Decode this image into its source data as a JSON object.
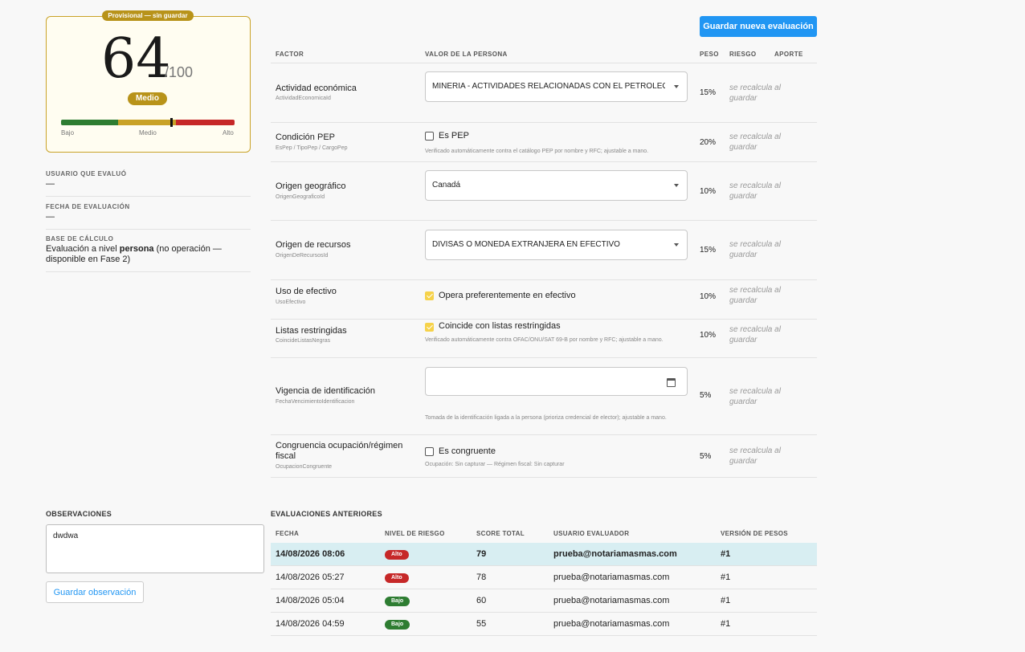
{
  "score_card": {
    "badge": "Provisional — sin guardar",
    "score": "64",
    "denominator": "/100",
    "level": "Medio",
    "gauge_labels": {
      "low": "Bajo",
      "mid": "Medio",
      "high": "Alto"
    },
    "gauge_value": 64
  },
  "meta": {
    "evaluator_label": "USUARIO QUE EVALUÓ",
    "evaluator_value": "—",
    "date_label": "FECHA DE EVALUACIÓN",
    "date_value": "—",
    "base_label": "BASE DE CÁLCULO",
    "base_pre": "Evaluación a nivel ",
    "base_bold": "persona",
    "base_post": " (no operación — disponible en Fase 2)"
  },
  "actions": {
    "save_new": "Guardar nueva evaluación",
    "save_obs": "Guardar observación"
  },
  "table_headers": {
    "factor": "FACTOR",
    "value": "VALOR DE LA PERSONA",
    "weight": "PESO",
    "risk": "RIESGO",
    "contribution": "APORTE"
  },
  "recalc_text": "se recalcula al guardar",
  "factors": [
    {
      "name": "Actividad económica",
      "code": "ActividadEconomicaId",
      "weight": "15%",
      "select": "MINERIA - ACTIVIDADES RELACIONADAS CON EL PETROLEO ..."
    },
    {
      "name": "Condición PEP",
      "code": "EsPep / TipoPep / CargoPep",
      "weight": "20%",
      "check": "Es PEP",
      "hint": "Verificado automáticamente contra el catálogo PEP por nombre y RFC; ajustable a mano."
    },
    {
      "name": "Origen geográfico",
      "code": "OrigenGeograficoId",
      "weight": "10%",
      "select": "Canadá"
    },
    {
      "name": "Origen de recursos",
      "code": "OrigenDeRecursosId",
      "weight": "15%",
      "select": "DIVISAS O MONEDA EXTRANJERA EN EFECTIVO"
    },
    {
      "name": "Uso de efectivo",
      "code": "UsoEfectivo",
      "weight": "10%",
      "check": "Opera preferentemente en efectivo"
    },
    {
      "name": "Listas restringidas",
      "code": "CoincideListasNegras",
      "weight": "10%",
      "check": "Coincide con listas restringidas",
      "hint": "Verificado automáticamente contra OFAC/ONU/SAT 69-B por nombre y RFC; ajustable a mano."
    },
    {
      "name": "Vigencia de identificación",
      "code": "FechaVencimientoIdentificacion",
      "weight": "5%",
      "hint": "Tomada de la identificación ligada a la persona (prioriza credencial de elector); ajustable a mano."
    },
    {
      "name": "Congruencia ocupación/régimen fiscal",
      "code": "OcupacionCongruente",
      "weight": "5%",
      "check": "Es congruente",
      "hint": "Ocupación: Sin capturar — Régimen fiscal: Sin capturar"
    }
  ],
  "observations": {
    "title": "OBSERVACIONES",
    "text": "dwdwa"
  },
  "history": {
    "title": "EVALUACIONES ANTERIORES",
    "headers": {
      "date": "FECHA",
      "level": "NIVEL DE RIESGO",
      "score": "SCORE TOTAL",
      "user": "USUARIO EVALUADOR",
      "version": "VERSIÓN DE PESOS"
    },
    "rows": [
      {
        "date": "14/08/2026 08:06",
        "level": "Alto",
        "score": "79",
        "user": "prueba@notariamasmas.com",
        "version": "#1"
      },
      {
        "date": "14/08/2026 05:27",
        "level": "Alto",
        "score": "78",
        "user": "prueba@notariamasmas.com",
        "version": "#1"
      },
      {
        "date": "14/08/2026 05:04",
        "level": "Bajo",
        "score": "60",
        "user": "prueba@notariamasmas.com",
        "version": "#1"
      },
      {
        "date": "14/08/2026 04:59",
        "level": "Bajo",
        "score": "55",
        "user": "prueba@notariamasmas.com",
        "version": "#1"
      }
    ]
  },
  "colors": {
    "accent": "#2196f3",
    "gold": "#b8931a",
    "high": "#c62828",
    "low": "#2e7d32",
    "selected_row": "#d8eef2"
  }
}
